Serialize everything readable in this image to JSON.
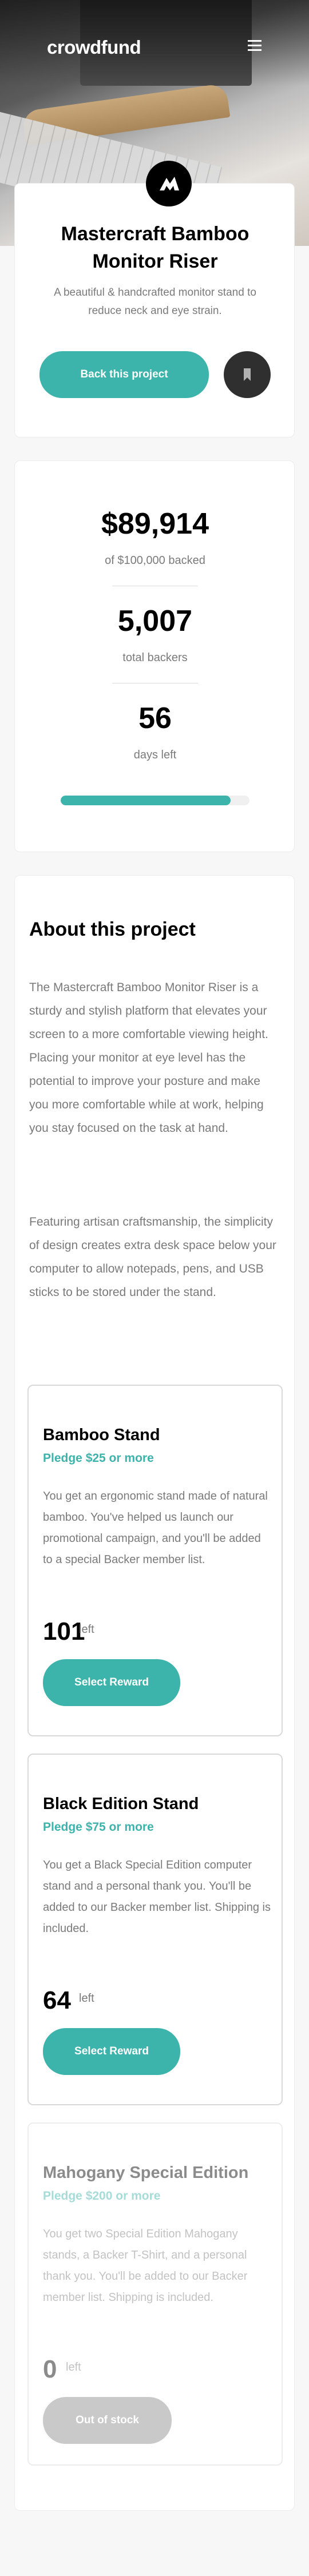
{
  "header": {
    "brand": "crowdfund",
    "menu_icon": "hamburger-menu-icon"
  },
  "intro": {
    "logo_icon": "mastercraft-logo-icon",
    "title": "Mastercraft Bamboo Monitor Riser",
    "subtitle": "A beautiful & handcrafted monitor stand to reduce neck and eye strain.",
    "back_label": "Back this project",
    "bookmark_icon": "bookmark-icon"
  },
  "stats": {
    "backed_amount": "$89,914",
    "backed_label": "of $100,000 backed",
    "backers_count": "5,007",
    "backers_label": "total backers",
    "days_count": "56",
    "days_label": "days left",
    "progress_fraction": 0.899
  },
  "about": {
    "heading": "About this project",
    "paragraphs": [
      "The Mastercraft Bamboo Monitor Riser is a sturdy and stylish platform that elevates your screen to a more comfortable viewing height. Placing your monitor at eye level has the potential to improve your posture and make you more comfortable while at work, helping you stay focused on the task at hand.",
      "Featuring artisan craftsmanship, the simplicity of design creates extra desk space below your computer to allow notepads, pens, and USB sticks to be stored under the stand."
    ],
    "rewards": [
      {
        "name": "Bamboo Stand",
        "pledge": "Pledge $25 or more",
        "description": "You get an ergonomic stand made of natural bamboo. You've helped us launch our promotional campaign, and you'll be added to a special Backer member list.",
        "left_count": "101",
        "left_label": "left",
        "button_label": "Select Reward"
      },
      {
        "name": "Black Edition Stand",
        "pledge": "Pledge $75 or more",
        "description": "You get a Black Special Edition computer stand and a personal thank you. You'll be added to our Backer member list. Shipping is included.",
        "left_count": "64",
        "left_label": "left",
        "button_label": "Select Reward"
      },
      {
        "name": "Mahogany Special Edition",
        "pledge": "Pledge $200 or more",
        "description": "You get two Special Edition Mahogany stands, a Backer T-Shirt, and a personal thank you. You'll be added to our Backer member list. Shipping is included.",
        "left_count": "0",
        "left_label": "left",
        "button_label": "Out of stock"
      }
    ]
  },
  "colors": {
    "accent": "#3cb3ab",
    "dark": "#2f2f2f",
    "muted_text": "#7a7a7a"
  }
}
